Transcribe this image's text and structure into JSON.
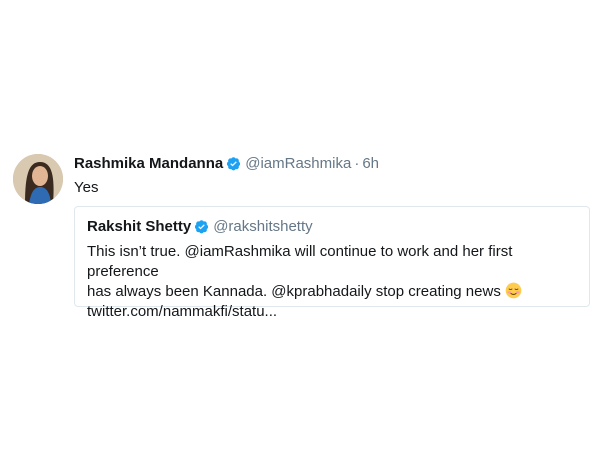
{
  "tweet": {
    "author_name": "Rashmika Mandanna",
    "author_handle": "@iamRashmika",
    "separator": "·",
    "time": "6h",
    "text": "Yes"
  },
  "quoted": {
    "author_name": "Rakshit Shetty",
    "author_handle": "@rakshitshetty",
    "text_line1": "This isn’t true. @iamRashmika will continue to work and her first preference",
    "text_line2": "has always been Kannada. @kprabhadaily stop creating news",
    "link": "twitter.com/nammakfi/statu..."
  },
  "colors": {
    "verified": "#1da1f2",
    "secondary_text": "#657786",
    "border": "#e1e8ed"
  },
  "icons": {
    "verified": "verified-badge-icon",
    "emoji": "relieved-face-emoji"
  }
}
